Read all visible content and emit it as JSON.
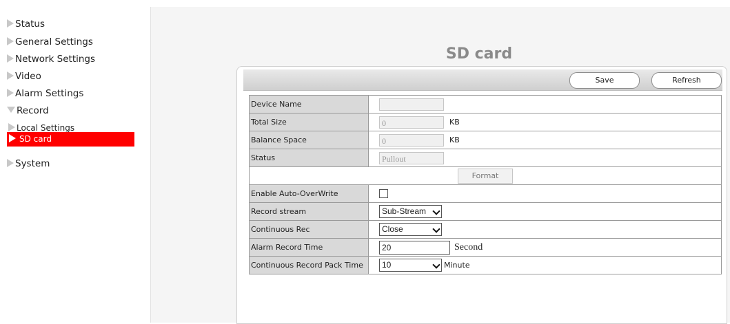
{
  "sidebar": {
    "items": [
      {
        "label": "Status"
      },
      {
        "label": "General Settings"
      },
      {
        "label": "Network Settings"
      },
      {
        "label": "Video"
      },
      {
        "label": "Alarm Settings"
      },
      {
        "label": "Record"
      },
      {
        "label": "Local Settings"
      },
      {
        "label": "SD card"
      },
      {
        "label": "System"
      }
    ],
    "active": "SD card",
    "active_color": "#ff0000"
  },
  "page": {
    "title": "SD card"
  },
  "toolbar": {
    "save_label": "Save",
    "refresh_label": "Refresh"
  },
  "form": {
    "device_name": {
      "label": "Device Name",
      "value": ""
    },
    "total_size": {
      "label": "Total Size",
      "value": "0",
      "unit": "KB"
    },
    "balance_space": {
      "label": "Balance Space",
      "value": "0",
      "unit": "KB"
    },
    "status": {
      "label": "Status",
      "value": "Pullout"
    },
    "format_label": "Format",
    "auto_overwrite": {
      "label": "Enable Auto-OverWrite",
      "checked": false
    },
    "record_stream": {
      "label": "Record stream",
      "value": "Sub-Stream"
    },
    "continuous_rec": {
      "label": "Continuous Rec",
      "value": "Close"
    },
    "alarm_record_time": {
      "label": "Alarm Record Time",
      "value": "20",
      "unit": "Second"
    },
    "pack_time": {
      "label": "Continuous Record Pack Time",
      "value": "10",
      "unit": "Minute"
    }
  }
}
